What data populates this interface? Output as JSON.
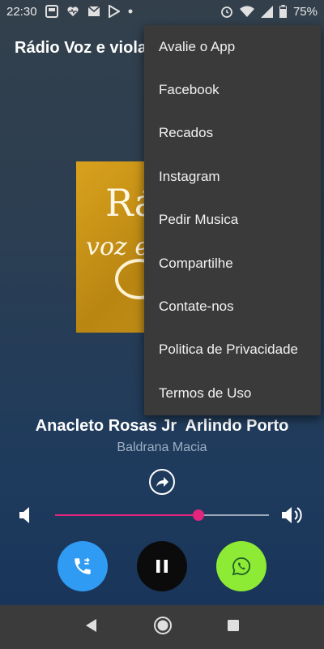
{
  "status_bar": {
    "time": "22:30",
    "battery_percent": "75%",
    "icons_left": [
      "photos-icon",
      "heart-monitor-icon",
      "gmail-icon",
      "play-store-icon",
      "dot-icon"
    ],
    "icons_right": [
      "alarm-icon",
      "wifi-icon",
      "cell-signal-icon",
      "battery-icon"
    ]
  },
  "app_bar": {
    "title": "Rádio Voz e viola"
  },
  "album_art": {
    "text_big": "Rá",
    "text_script": "voz e"
  },
  "now_playing": {
    "title": "Anacleto Rosas Jr  Arlindo Porto",
    "subtitle": "Baldrana Macia"
  },
  "volume": {
    "level_fraction": 0.67,
    "accent_color": "#e4257c"
  },
  "controls": {
    "call_icon": "phone-forward-icon",
    "play_state_icon": "pause-icon",
    "whatsapp_icon": "whatsapp-icon",
    "call_color": "#2f9bf2",
    "pause_color": "#0b0b0b",
    "whatsapp_color": "#8dea35"
  },
  "menu": {
    "items": [
      "Avalie o App",
      "Facebook",
      "Recados",
      "Instagram",
      "Pedir Musica",
      "Compartilhe",
      "Contate-nos",
      "Politica de Privacidade",
      "Termos de Uso"
    ]
  },
  "nav_bar": {
    "back_icon": "back-icon",
    "home_icon": "home-icon",
    "recents_icon": "recents-icon"
  }
}
